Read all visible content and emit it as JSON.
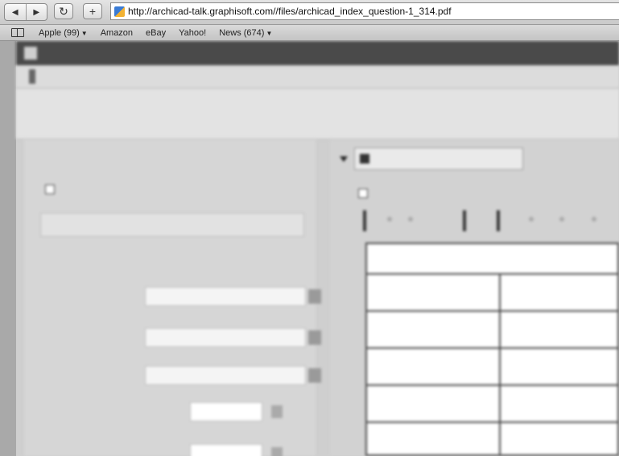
{
  "toolbar": {
    "back_icon": "back-arrow-icon",
    "forward_icon": "forward-arrow-icon",
    "reload_icon": "reload-icon",
    "add_icon": "plus-icon",
    "url": "http://archicad-talk.graphisoft.com//files/archicad_index_question-1_314.pdf"
  },
  "bookmarks": {
    "items": [
      {
        "label": "Apple (99)",
        "dropdown": true
      },
      {
        "label": "Amazon",
        "dropdown": false
      },
      {
        "label": "eBay",
        "dropdown": false
      },
      {
        "label": "Yahoo!",
        "dropdown": false
      },
      {
        "label": "News (674)",
        "dropdown": true
      }
    ]
  },
  "colors": {
    "window_title_bar": "#4a4a4a",
    "toolbar_bg": "#d6d6d6"
  }
}
